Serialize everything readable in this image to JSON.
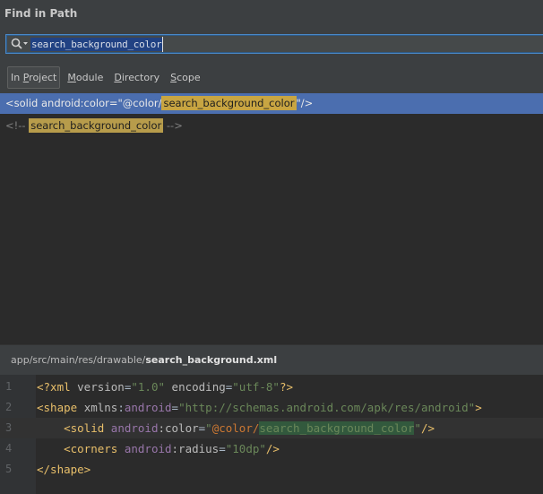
{
  "dialog": {
    "title": "Find in Path"
  },
  "search": {
    "query": "search_background_color"
  },
  "scopes": [
    {
      "label": "In Project",
      "mnemonic_index": 3,
      "active": true
    },
    {
      "label": "Module",
      "mnemonic_index": 0,
      "active": false
    },
    {
      "label": "Directory",
      "mnemonic_index": 0,
      "active": false
    },
    {
      "label": "Scope",
      "mnemonic_index": 0,
      "active": false
    }
  ],
  "results": [
    {
      "prefix": "<solid android:color=\"@color/",
      "match": "search_background_color",
      "suffix": "\"/>",
      "selected": true
    },
    {
      "prefix": "<!-- ",
      "match": "search_background_color",
      "suffix": " -->",
      "selected": false
    }
  ],
  "preview": {
    "path_prefix": "app/src/main/res/drawable/",
    "filename": "search_background.xml"
  },
  "editor": {
    "line_numbers": [
      "1",
      "2",
      "3",
      "4",
      "5"
    ],
    "lines": [
      [
        {
          "t": "<?xml ",
          "c": "t-tag"
        },
        {
          "t": "version",
          "c": "t-attr"
        },
        {
          "t": "=",
          "c": "t-pl"
        },
        {
          "t": "\"1.0\"",
          "c": "t-str"
        },
        {
          "t": " encoding",
          "c": "t-attr"
        },
        {
          "t": "=",
          "c": "t-pl"
        },
        {
          "t": "\"utf-8\"",
          "c": "t-str"
        },
        {
          "t": "?>",
          "c": "t-tag"
        }
      ],
      [
        {
          "t": "<shape ",
          "c": "t-tag"
        },
        {
          "t": "xmlns",
          "c": "t-attr"
        },
        {
          "t": ":",
          "c": "t-pl"
        },
        {
          "t": "android",
          "c": "t-ns"
        },
        {
          "t": "=",
          "c": "t-pl"
        },
        {
          "t": "\"http://schemas.android.com/apk/res/android\"",
          "c": "t-str"
        },
        {
          "t": ">",
          "c": "t-tag"
        }
      ],
      [
        {
          "t": "    ",
          "c": "t-pl"
        },
        {
          "t": "<solid ",
          "c": "t-tag"
        },
        {
          "t": "android",
          "c": "t-ns"
        },
        {
          "t": ":color",
          "c": "t-attr"
        },
        {
          "t": "=",
          "c": "t-pl"
        },
        {
          "t": "\"",
          "c": "t-str"
        },
        {
          "t": "@color/",
          "c": "t-ref"
        },
        {
          "t": "search_background_color",
          "c": "t-hl"
        },
        {
          "t": "\"",
          "c": "t-str"
        },
        {
          "t": "/>",
          "c": "t-tag"
        }
      ],
      [
        {
          "t": "    ",
          "c": "t-pl"
        },
        {
          "t": "<corners ",
          "c": "t-tag"
        },
        {
          "t": "android",
          "c": "t-ns"
        },
        {
          "t": ":radius",
          "c": "t-attr"
        },
        {
          "t": "=",
          "c": "t-pl"
        },
        {
          "t": "\"10dp\"",
          "c": "t-str"
        },
        {
          "t": "/>",
          "c": "t-tag"
        }
      ],
      [
        {
          "t": "</shape>",
          "c": "t-tag"
        }
      ]
    ],
    "current_line": 3
  },
  "colors": {
    "window_bg": "#3c3f41",
    "editor_bg": "#2b2b2b",
    "selection": "#4b6eaf",
    "match_highlight": "#c8a542"
  }
}
